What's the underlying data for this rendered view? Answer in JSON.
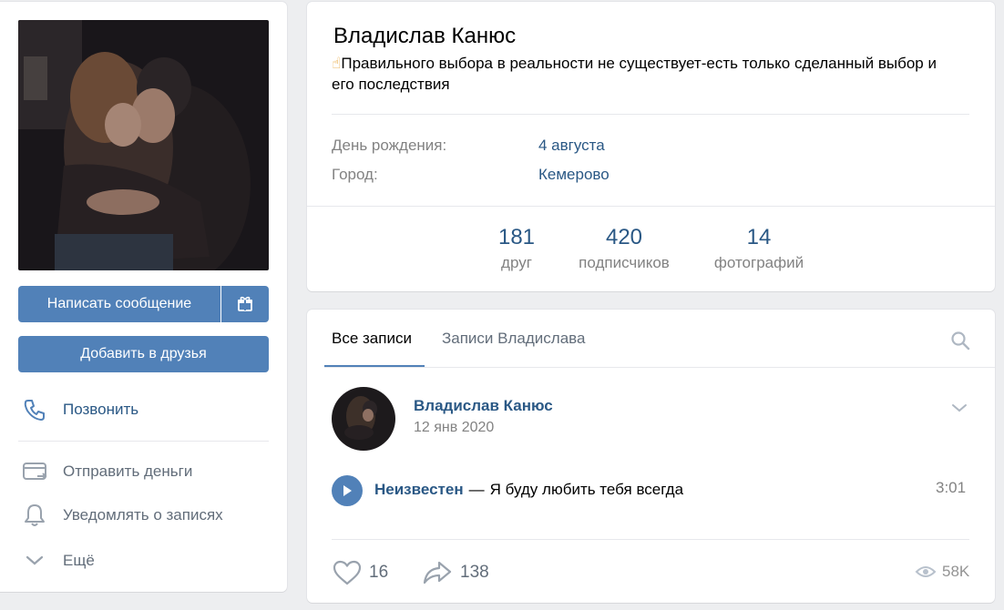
{
  "profile": {
    "name": "Владислав Канюс",
    "status_emoji": "☝",
    "status": "Правильного выбора в реальности не существует-есть только сделанный выбор и его последствия",
    "info": [
      {
        "label": "День рождения:",
        "value": "4 августа"
      },
      {
        "label": "Город:",
        "value": "Кемерово"
      }
    ],
    "counters": [
      {
        "num": "181",
        "label": "друг"
      },
      {
        "num": "420",
        "label": "подписчиков"
      },
      {
        "num": "14",
        "label": "фотографий"
      }
    ]
  },
  "actions": {
    "message_label": "Написать сообщение",
    "gift_icon": "gift-icon",
    "add_friend_label": "Добавить в друзья",
    "call_label": "Позвонить",
    "send_money_label": "Отправить деньги",
    "notify_label": "Уведомлять о записях",
    "more_label": "Ещё"
  },
  "wall": {
    "tabs": [
      "Все записи",
      "Записи Владислава"
    ],
    "post": {
      "author": "Владислав Канюс",
      "date": "12 янв 2020",
      "audio": {
        "artist": "Неизвестен",
        "dash": "—",
        "title": "Я буду любить тебя всегда",
        "duration": "3:01"
      },
      "likes": "16",
      "shares": "138",
      "views": "58K"
    }
  },
  "colors": {
    "accent": "#5181b8",
    "link": "#2a5885",
    "muted": "#828282",
    "background": "#edeef0"
  }
}
